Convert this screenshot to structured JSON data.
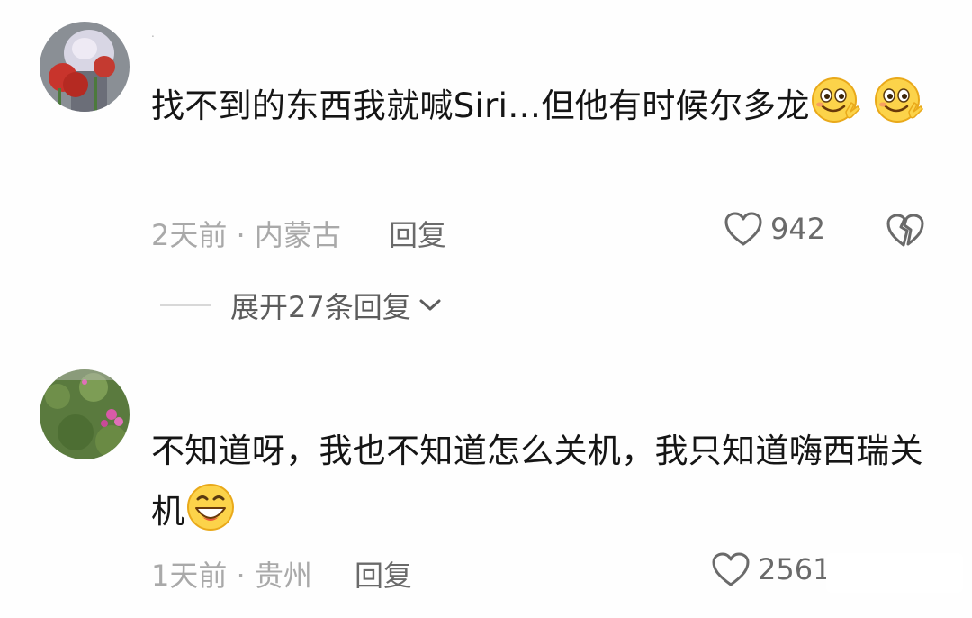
{
  "comments": [
    {
      "username": ".",
      "text": "找不到的东西我就喊Siri…但他有时候尔多龙",
      "emoji_icon": "wink-smile-emoji-icon",
      "time_location": "2天前 · 内蒙古",
      "reply_label": "回复",
      "likes": "942",
      "expand_label": "展开27条回复"
    },
    {
      "text": "不知道呀，我也不知道怎么关机，我只知道嗨西瑞关机",
      "emoji_icon": "grin-emoji-icon",
      "time_location": "1天前 · 贵州",
      "reply_label": "回复",
      "likes": "2561"
    }
  ]
}
